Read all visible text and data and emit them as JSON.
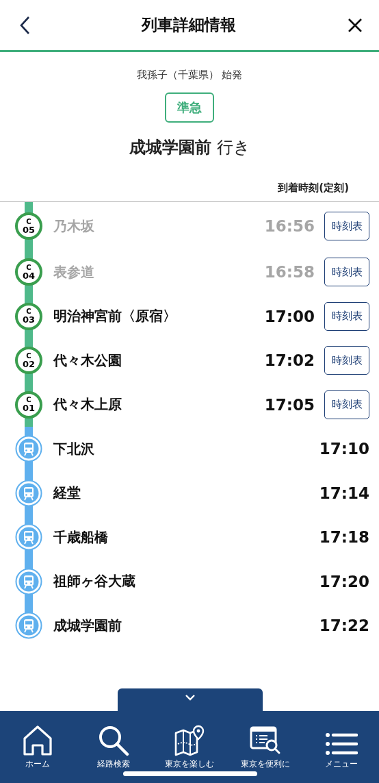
{
  "header": {
    "title": "列車詳細情報"
  },
  "train": {
    "origin": "我孫子（千葉県） 始発",
    "type": "準急",
    "destination": "成城学園前",
    "destination_suffix": "行き"
  },
  "column_header": "到着時刻(定刻)",
  "stops": [
    {
      "kind": "metro",
      "line": "C",
      "number": "05",
      "name": "乃木坂",
      "time": "16:56",
      "passed": true,
      "button": "時刻表"
    },
    {
      "kind": "metro",
      "line": "C",
      "number": "04",
      "name": "表参道",
      "time": "16:58",
      "passed": true,
      "button": "時刻表"
    },
    {
      "kind": "metro",
      "line": "C",
      "number": "03",
      "name": "明治神宮前〈原宿〉",
      "time": "17:00",
      "passed": false,
      "button": "時刻表"
    },
    {
      "kind": "metro",
      "line": "C",
      "number": "02",
      "name": "代々木公園",
      "time": "17:02",
      "passed": false,
      "button": "時刻表"
    },
    {
      "kind": "metro",
      "line": "C",
      "number": "01",
      "name": "代々木上原",
      "time": "17:05",
      "passed": false,
      "button": "時刻表"
    },
    {
      "kind": "rail",
      "name": "下北沢",
      "time": "17:10",
      "passed": false
    },
    {
      "kind": "rail",
      "name": "経堂",
      "time": "17:14",
      "passed": false
    },
    {
      "kind": "rail",
      "name": "千歳船橋",
      "time": "17:18",
      "passed": false
    },
    {
      "kind": "rail",
      "name": "祖師ヶ谷大蔵",
      "time": "17:20",
      "passed": false
    },
    {
      "kind": "rail",
      "name": "成城学園前",
      "time": "17:22",
      "passed": false
    }
  ],
  "bottom_nav": [
    {
      "kind": "home",
      "label": "ホーム"
    },
    {
      "kind": "search",
      "label": "経路検索"
    },
    {
      "kind": "map",
      "label": "東京を楽しむ"
    },
    {
      "kind": "info",
      "label": "東京を便利に"
    },
    {
      "kind": "menu",
      "label": "メニュー"
    }
  ]
}
